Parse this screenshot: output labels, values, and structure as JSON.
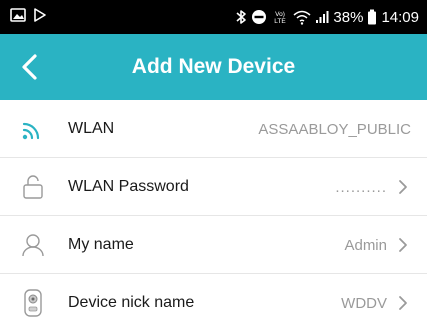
{
  "status_bar": {
    "battery_percent": "38%",
    "time": "14:09",
    "volte_label": "VoLTE",
    "colors": {
      "background": "#000000",
      "text": "#ffffff"
    }
  },
  "header": {
    "title": "Add New Device",
    "background_color": "#2ab3c3"
  },
  "rows": [
    {
      "label": "WLAN",
      "value": "ASSAABLOY_PUBLIC",
      "icon": "wifi-icon"
    },
    {
      "label": "WLAN Password",
      "value": "..........",
      "icon": "lock-icon"
    },
    {
      "label": "My name",
      "value": "Admin",
      "icon": "user-icon"
    },
    {
      "label": "Device nick name",
      "value": "WDDV",
      "icon": "device-icon"
    }
  ],
  "colors": {
    "accent": "#2ab3c3",
    "value_text": "#9a9a9a",
    "label_text": "#1a1a1a",
    "divider": "#e6e6e6"
  }
}
